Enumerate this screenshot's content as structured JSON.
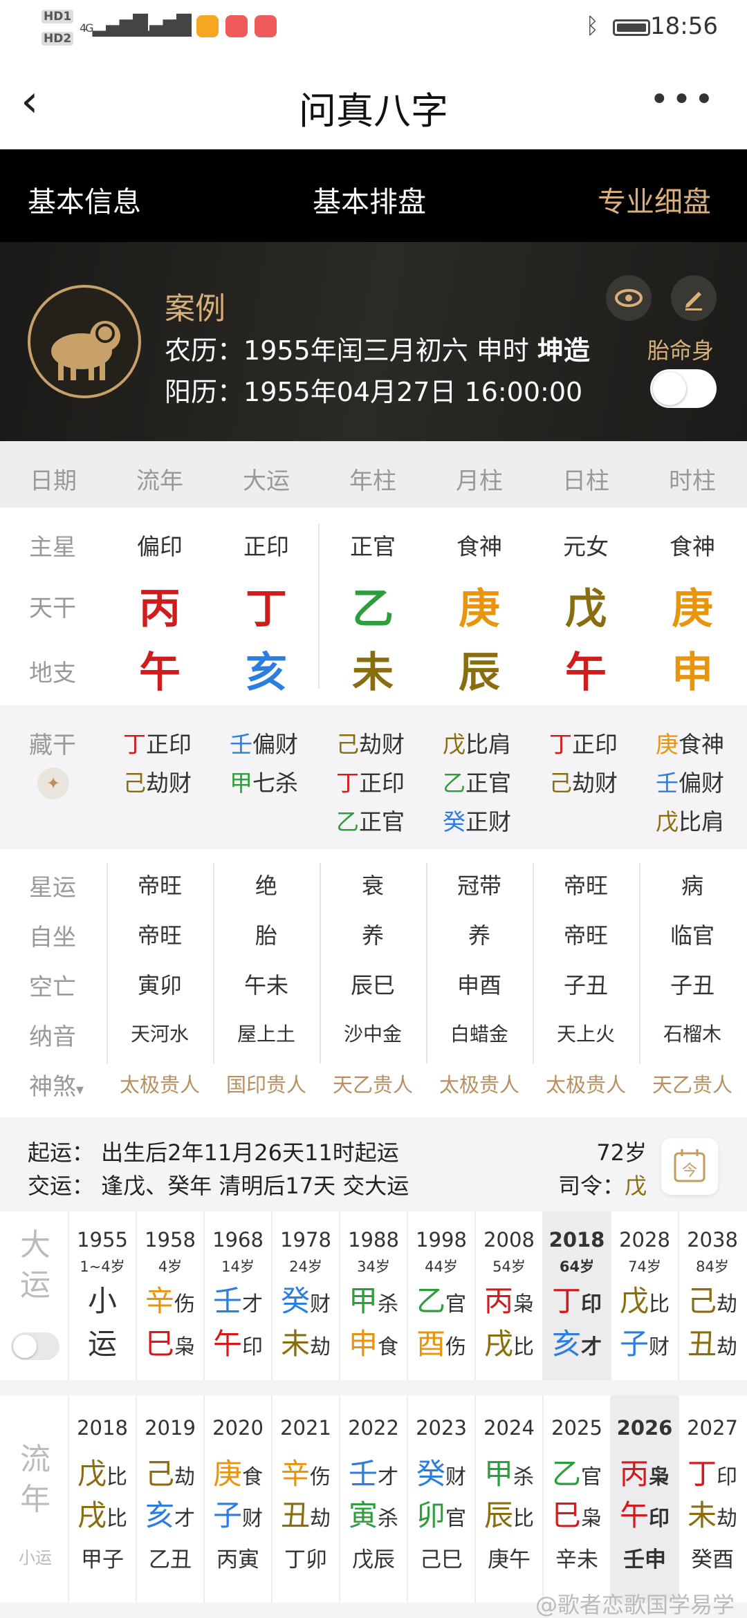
{
  "status": {
    "time": "18:56",
    "hd1": "HD1",
    "hd2": "HD2",
    "sig1": "4G",
    "sig2": "4G"
  },
  "nav": {
    "title": "问真八字",
    "back_icon": "chevron-left-icon",
    "more_icon": "more-horizontal-icon"
  },
  "tabs": [
    {
      "label": "基本信息",
      "active": false
    },
    {
      "label": "基本排盘",
      "active": false
    },
    {
      "label": "专业细盘",
      "active": true
    }
  ],
  "profile": {
    "name": "案例",
    "lunar_prefix": "农历：",
    "lunar": "1955年闰三月初六 申时 ",
    "gender": "坤造",
    "solar_prefix": "阳历：",
    "solar": "1955年04月27日 16:00:00",
    "taiming_label": "胎命身",
    "taiming_on": false
  },
  "columns": [
    "日期",
    "流年",
    "大运",
    "年柱",
    "月柱",
    "日柱",
    "时柱"
  ],
  "row_labels": {
    "main_star": "主星",
    "tiangan": "天干",
    "dizhi": "地支",
    "canggan": "藏干",
    "xingyun": "星运",
    "zizuo": "自坐",
    "kongwang": "空亡",
    "nayin": "纳音",
    "shensha": "神煞"
  },
  "main_stars": [
    "偏印",
    "正印",
    "正官",
    "食神",
    "元女",
    "食神"
  ],
  "tiangan": [
    {
      "c": "丙",
      "color": "#d01c1c"
    },
    {
      "c": "丁",
      "color": "#d01c1c"
    },
    {
      "c": "乙",
      "color": "#2e9d3b"
    },
    {
      "c": "庚",
      "color": "#e8940c"
    },
    {
      "c": "戊",
      "color": "#8a6d0e"
    },
    {
      "c": "庚",
      "color": "#e8940c"
    }
  ],
  "dizhi": [
    {
      "c": "午",
      "color": "#d01c1c"
    },
    {
      "c": "亥",
      "color": "#2b7de0"
    },
    {
      "c": "未",
      "color": "#8a6d0e"
    },
    {
      "c": "辰",
      "color": "#8a6d0e"
    },
    {
      "c": "午",
      "color": "#d01c1c"
    },
    {
      "c": "申",
      "color": "#e8940c"
    }
  ],
  "canggan": [
    [
      {
        "g": "丁",
        "t": "正印",
        "color": "#d01c1c"
      },
      {
        "g": "己",
        "t": "劫财",
        "color": "#8a6d0e"
      }
    ],
    [
      {
        "g": "壬",
        "t": "偏财",
        "color": "#2b7de0"
      },
      {
        "g": "甲",
        "t": "七杀",
        "color": "#2e9d3b"
      }
    ],
    [
      {
        "g": "己",
        "t": "劫财",
        "color": "#8a6d0e"
      },
      {
        "g": "丁",
        "t": "正印",
        "color": "#d01c1c"
      },
      {
        "g": "乙",
        "t": "正官",
        "color": "#2e9d3b"
      }
    ],
    [
      {
        "g": "戊",
        "t": "比肩",
        "color": "#8a6d0e"
      },
      {
        "g": "乙",
        "t": "正官",
        "color": "#2e9d3b"
      },
      {
        "g": "癸",
        "t": "正财",
        "color": "#2b7de0"
      }
    ],
    [
      {
        "g": "丁",
        "t": "正印",
        "color": "#d01c1c"
      },
      {
        "g": "己",
        "t": "劫财",
        "color": "#8a6d0e"
      }
    ],
    [
      {
        "g": "庚",
        "t": "食神",
        "color": "#e8940c"
      },
      {
        "g": "壬",
        "t": "偏财",
        "color": "#2b7de0"
      },
      {
        "g": "戊",
        "t": "比肩",
        "color": "#8a6d0e"
      }
    ]
  ],
  "xingyun": [
    "帝旺",
    "绝",
    "衰",
    "冠带",
    "帝旺",
    "病"
  ],
  "zizuo": [
    "帝旺",
    "胎",
    "养",
    "养",
    "帝旺",
    "临官"
  ],
  "kongwang": [
    "寅卯",
    "午未",
    "辰巳",
    "申酉",
    "子丑",
    "子丑"
  ],
  "nayin": [
    "天河水",
    "屋上土",
    "沙中金",
    "白蜡金",
    "天上火",
    "石榴木"
  ],
  "shensha": [
    "太极贵人",
    "国印贵人",
    "天乙贵人",
    "太极贵人",
    "太极贵人",
    "天乙贵人"
  ],
  "qiyun": {
    "line1": "起运：  出生后2年11月26天11时起运",
    "line2": "交运：  逢戊、癸年 清明后17天 交大运",
    "age": "72岁",
    "siling_label": "司令：",
    "siling": "戊",
    "siling_color": "#8a6d0e"
  },
  "dayun_label": [
    "大",
    "运"
  ],
  "dayun": [
    {
      "year": "1955",
      "age": "1~4岁",
      "g": "小",
      "gs": "",
      "gc": "#333333",
      "z": "运",
      "zs": "",
      "zc": "#333333",
      "current": false
    },
    {
      "year": "1958",
      "age": "4岁",
      "g": "辛",
      "gs": "伤",
      "gc": "#e8940c",
      "z": "巳",
      "zs": "枭",
      "zc": "#d01c1c",
      "current": false
    },
    {
      "year": "1968",
      "age": "14岁",
      "g": "壬",
      "gs": "才",
      "gc": "#2b7de0",
      "z": "午",
      "zs": "印",
      "zc": "#d01c1c",
      "current": false
    },
    {
      "year": "1978",
      "age": "24岁",
      "g": "癸",
      "gs": "财",
      "gc": "#2b7de0",
      "z": "未",
      "zs": "劫",
      "zc": "#8a6d0e",
      "current": false
    },
    {
      "year": "1988",
      "age": "34岁",
      "g": "甲",
      "gs": "杀",
      "gc": "#2e9d3b",
      "z": "申",
      "zs": "食",
      "zc": "#e8940c",
      "current": false
    },
    {
      "year": "1998",
      "age": "44岁",
      "g": "乙",
      "gs": "官",
      "gc": "#2e9d3b",
      "z": "酉",
      "zs": "伤",
      "zc": "#e8940c",
      "current": false
    },
    {
      "year": "2008",
      "age": "54岁",
      "g": "丙",
      "gs": "枭",
      "gc": "#d01c1c",
      "z": "戌",
      "zs": "比",
      "zc": "#8a6d0e",
      "current": false
    },
    {
      "year": "2018",
      "age": "64岁",
      "g": "丁",
      "gs": "印",
      "gc": "#d01c1c",
      "z": "亥",
      "zs": "才",
      "zc": "#2b7de0",
      "current": true
    },
    {
      "year": "2028",
      "age": "74岁",
      "g": "戊",
      "gs": "比",
      "gc": "#8a6d0e",
      "z": "子",
      "zs": "财",
      "zc": "#2b7de0",
      "current": false
    },
    {
      "year": "2038",
      "age": "84岁",
      "g": "己",
      "gs": "劫",
      "gc": "#8a6d0e",
      "z": "丑",
      "zs": "劫",
      "zc": "#8a6d0e",
      "current": false
    }
  ],
  "liunian_label": [
    "流",
    "年"
  ],
  "xiaoyun_label": "小运",
  "liunian": [
    {
      "year": "2018",
      "g": "戊",
      "gs": "比",
      "gc": "#8a6d0e",
      "z": "戌",
      "zs": "比",
      "zc": "#8a6d0e",
      "xy": "甲子",
      "current": false
    },
    {
      "year": "2019",
      "g": "己",
      "gs": "劫",
      "gc": "#8a6d0e",
      "z": "亥",
      "zs": "才",
      "zc": "#2b7de0",
      "xy": "乙丑",
      "current": false
    },
    {
      "year": "2020",
      "g": "庚",
      "gs": "食",
      "gc": "#e8940c",
      "z": "子",
      "zs": "财",
      "zc": "#2b7de0",
      "xy": "丙寅",
      "current": false
    },
    {
      "year": "2021",
      "g": "辛",
      "gs": "伤",
      "gc": "#e8940c",
      "z": "丑",
      "zs": "劫",
      "zc": "#8a6d0e",
      "xy": "丁卯",
      "current": false
    },
    {
      "year": "2022",
      "g": "壬",
      "gs": "才",
      "gc": "#2b7de0",
      "z": "寅",
      "zs": "杀",
      "zc": "#2e9d3b",
      "xy": "戊辰",
      "current": false
    },
    {
      "year": "2023",
      "g": "癸",
      "gs": "财",
      "gc": "#2b7de0",
      "z": "卯",
      "zs": "官",
      "zc": "#2e9d3b",
      "xy": "己巳",
      "current": false
    },
    {
      "year": "2024",
      "g": "甲",
      "gs": "杀",
      "gc": "#2e9d3b",
      "z": "辰",
      "zs": "比",
      "zc": "#8a6d0e",
      "xy": "庚午",
      "current": false
    },
    {
      "year": "2025",
      "g": "乙",
      "gs": "官",
      "gc": "#2e9d3b",
      "z": "巳",
      "zs": "枭",
      "zc": "#d01c1c",
      "xy": "辛未",
      "current": false
    },
    {
      "year": "2026",
      "g": "丙",
      "gs": "枭",
      "gc": "#d01c1c",
      "z": "午",
      "zs": "印",
      "zc": "#d01c1c",
      "xy": "壬申",
      "current": true
    },
    {
      "year": "2027",
      "g": "丁",
      "gs": "印",
      "gc": "#d01c1c",
      "z": "未",
      "zs": "劫",
      "zc": "#8a6d0e",
      "xy": "癸酉",
      "current": false
    }
  ],
  "watermark": "@歌者恋歌国学易学"
}
